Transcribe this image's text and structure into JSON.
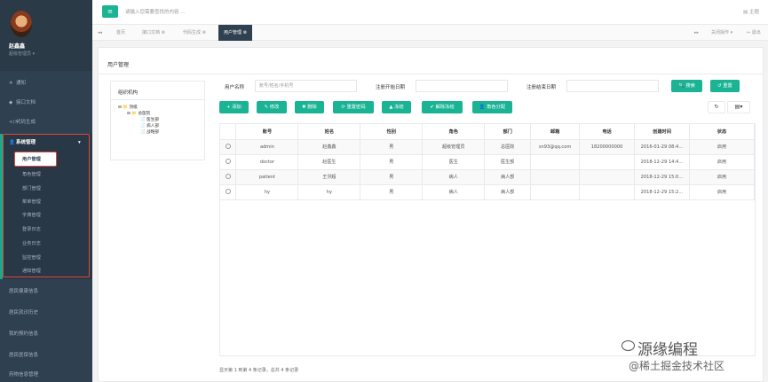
{
  "user": {
    "name": "赵鑫鑫",
    "role": "超级管理员 ▾"
  },
  "sidebar": {
    "top_items": [
      {
        "icon": "✈",
        "label": "通知"
      },
      {
        "icon": "◆",
        "label": "接口文档"
      },
      {
        "icon": "</>",
        "label": "代码生成"
      }
    ],
    "system": {
      "icon": "👤",
      "label": "系统管理",
      "chevron": "▾"
    },
    "sub_items": [
      "用户管理",
      "角色管理",
      "部门管理",
      "菜单管理",
      "字典管理",
      "登录日志",
      "业务日志",
      "监控管理",
      "通知管理"
    ],
    "bottom_items": [
      "居民健康信息",
      "居民就诊历史",
      "我的预约信息",
      "居民医保信息",
      "药物信息管理"
    ]
  },
  "topbar": {
    "menu_icon": "≡",
    "search_placeholder": "请输入您需要查找的内容 …",
    "theme_label": "主题",
    "theme_icon": "▤"
  },
  "tabs": {
    "prev": "◂◂",
    "items": [
      "首页",
      "接口文档 ⊗",
      "代码生成 ⊗",
      "用户管理 ⊗"
    ],
    "next": "▸▸",
    "close_ops": "关闭操作 ▾",
    "logout": "↦ 退出"
  },
  "page": {
    "title": "用户管理"
  },
  "org": {
    "title": "组织机构",
    "tree": [
      "⊟ 📁 顶级",
      "⊟ 📁 总医院",
      "📄 医生部",
      "📄 病人部",
      "📄 战略部"
    ]
  },
  "filters": {
    "username_label": "用户名称",
    "username_placeholder": "账号/姓名/手机号",
    "start_label": "注册开始日期",
    "end_label": "注册结束日期",
    "search_button": "🔍 搜索",
    "reset_button": "↺ 重置"
  },
  "toolbar": {
    "add": "+ 添加",
    "edit": "✎ 修改",
    "delete": "✖ 删除",
    "reset_pwd": "⟳ 重置密码",
    "freeze": "▲ 冻结",
    "unfreeze": "✔ 解除冻结",
    "assign_role": "👤 角色分配",
    "refresh": "↻",
    "columns": "▤▾"
  },
  "table": {
    "headers": [
      "",
      "账号",
      "姓名",
      "性别",
      "角色",
      "部门",
      "邮箱",
      "电话",
      "创建时间",
      "状态"
    ],
    "rows": [
      [
        "",
        "admin",
        "赵鑫鑫",
        "男",
        "超级管理员",
        "总医院",
        "sn93@qq.com",
        "18200000000",
        "2016-01-29 08:4…",
        "启用"
      ],
      [
        "",
        "doctor",
        "赵医生",
        "男",
        "医生",
        "医生部",
        "",
        "",
        "2018-12-29 14:4…",
        "启用"
      ],
      [
        "",
        "patient",
        "王洪超",
        "男",
        "病人",
        "病人部",
        "",
        "",
        "2018-12-29 15:0…",
        "启用"
      ],
      [
        "",
        "hy",
        "hy",
        "男",
        "病人",
        "病人部",
        "",
        "",
        "2018-12-29 15:2…",
        "启用"
      ]
    ]
  },
  "summary": "显示第 1 到第 4 条记录，总共 4 条记录",
  "watermark": {
    "line1": "源缘编程",
    "line2": "@稀土掘金技术社区"
  },
  "colors": {
    "sidebar": "#2f4050",
    "accent": "#1ab394",
    "highlight": "#e0483b"
  }
}
